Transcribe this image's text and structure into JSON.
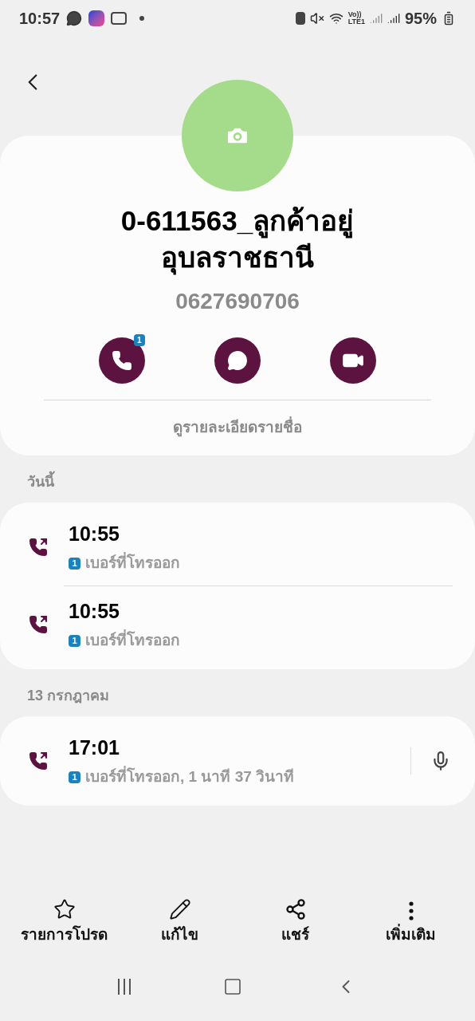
{
  "status_bar": {
    "time": "10:57",
    "network": "Vo))",
    "network_sub": "LTE1",
    "battery": "95%"
  },
  "contact": {
    "name": "0-611563_ลูกค้าอยู่อุบลราชธานี",
    "phone": "0627690706",
    "call_badge": "1",
    "details_link": "ดูรายละเอียดรายชื่อ"
  },
  "sections": [
    {
      "title": "วันนี้",
      "calls": [
        {
          "time": "10:55",
          "sim": "1",
          "detail": "เบอร์ที่โทรออก",
          "recording": false
        },
        {
          "time": "10:55",
          "sim": "1",
          "detail": "เบอร์ที่โทรออก",
          "recording": false
        }
      ]
    },
    {
      "title": "13 กรกฎาคม",
      "calls": [
        {
          "time": "17:01",
          "sim": "1",
          "detail": "เบอร์ที่โทรออก, 1 นาที 37 วินาที",
          "recording": true
        }
      ]
    }
  ],
  "bottom_actions": [
    {
      "kind": "star",
      "label": "รายการโปรด"
    },
    {
      "kind": "edit",
      "label": "แก้ไข"
    },
    {
      "kind": "share",
      "label": "แชร์"
    },
    {
      "kind": "more",
      "label": "เพิ่มเติม"
    }
  ]
}
